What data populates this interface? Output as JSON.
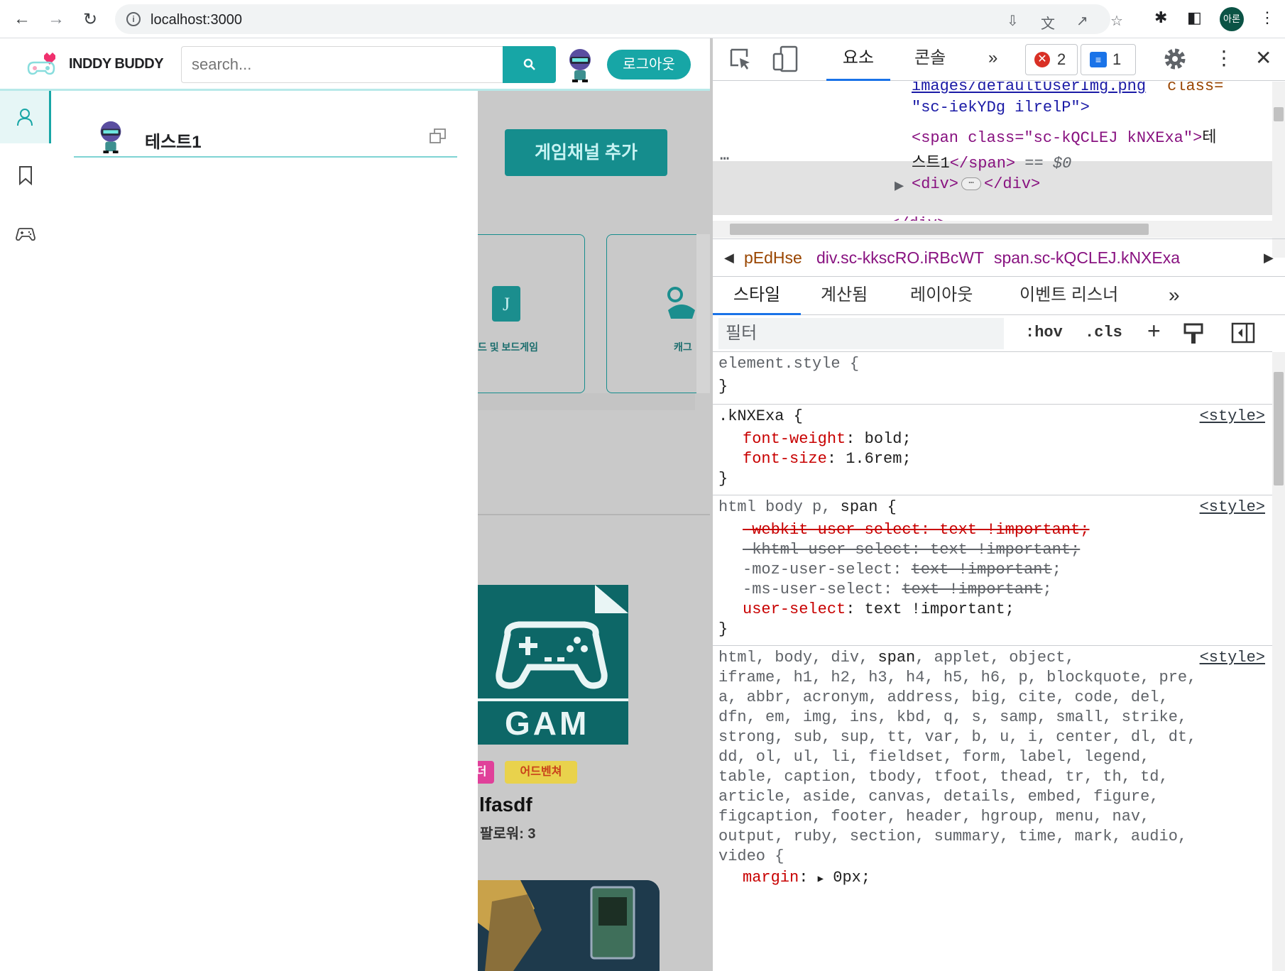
{
  "browser": {
    "url": "localhost:3000",
    "profile_label": "아론"
  },
  "app": {
    "logo_text": "INDDY BUDDY",
    "search_placeholder": "search...",
    "logout_label": "로그아웃",
    "panel_user_name": "테스트1",
    "add_channel_label": "게임채널 추가",
    "category_cards": [
      {
        "label": "드 및 보드게임"
      },
      {
        "label": "캐그"
      }
    ],
    "game_tags": [
      {
        "label": "더"
      },
      {
        "label": "어드벤쳐"
      }
    ],
    "game_image_text": "GAM",
    "game_title": "lfasdf",
    "game_followers": "팔로워: 3"
  },
  "devtools": {
    "tabs": [
      "요소",
      "콘솔"
    ],
    "error_count": "2",
    "message_count": "1",
    "elements": {
      "line1_a": "images/defaultUserImg.png",
      "line1_b": "class=",
      "line2": "\"sc-iekYDg ilrelP\">",
      "sel_open": "<span class=\"sc-kQCLEJ kNXExa\">",
      "sel_text_a": "테",
      "sel_text_b": "스트1",
      "sel_close": "</span>",
      "sel_eq": " == $0",
      "div_open": "<div>",
      "div_close": "</div>",
      "partial": "</div>"
    },
    "breadcrumbs": [
      "pEdHse",
      "div.sc-kkscRO.iRBcWT",
      "span.sc-kQCLEJ.kNXExa"
    ],
    "subtabs": [
      "스타일",
      "계산됨",
      "레이아웃",
      "이벤트 리스너"
    ],
    "filter_placeholder": "필터",
    "hov": ":hov",
    "cls": ".cls",
    "rules": {
      "element_style": "element.style {",
      "close": "}",
      "r1_selector": ".kNXExa {",
      "r1_src": "<style>",
      "r1_p1_name": "font-weight",
      "r1_p1_val": "bold;",
      "r1_p2_name": "font-size",
      "r1_p2_val": "1.6rem;",
      "r2_selector_a": "html body p, ",
      "r2_selector_b": "span",
      "r2_selector_c": " {",
      "r2_src": "<style>",
      "r2_l1": "-webkit-user-select: text !important;",
      "r2_l2": "-khtml-user-select: text !important;",
      "r2_l3_name": "-moz-user-select: ",
      "r2_l3_val": "text !important",
      "r2_l4_name": "-ms-user-select: ",
      "r2_l4_val": "text !important",
      "r2_l5_name": "user-select",
      "r2_l5_val": "text !important;",
      "r3_src": "<style>",
      "r3_l1a": "html, body, div, ",
      "r3_l1b": "span",
      "r3_l1c": ", applet, object,",
      "r3_l2": "iframe, h1, h2, h3, h4, h5, h6, p, blockquote, pre,",
      "r3_l3": "a, abbr, acronym, address, big, cite, code, del,",
      "r3_l4": "dfn, em, img, ins, kbd, q, s, samp, small, strike,",
      "r3_l5": "strong, sub, sup, tt, var, b, u, i, center, dl, dt,",
      "r3_l6": "dd, ol, ul, li, fieldset, form, label, legend,",
      "r3_l7": "table, caption, tbody, tfoot, thead, tr, th, td,",
      "r3_l8": "article, aside, canvas, details, embed, figure,",
      "r3_l9": "figcaption, footer, header, hgroup, menu, nav,",
      "r3_l10": "output, ruby, section, summary, time, mark, audio,",
      "r3_l11": "video {",
      "r3_l12_name": "margin",
      "r3_l12_val": "0px;"
    }
  }
}
